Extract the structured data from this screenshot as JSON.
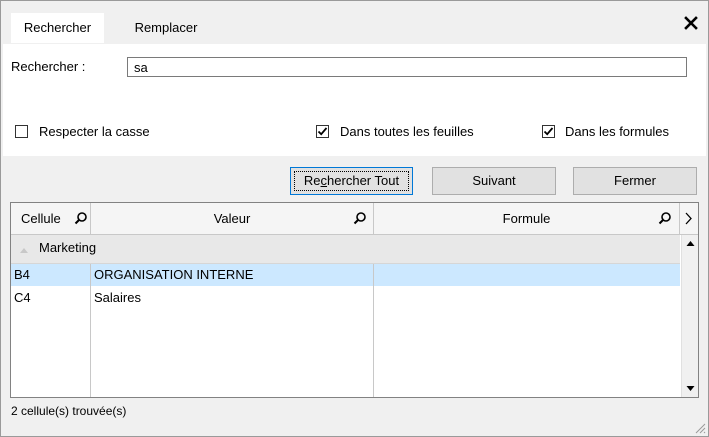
{
  "tabs": [
    {
      "label": "Rechercher",
      "active": true
    },
    {
      "label": "Remplacer",
      "active": false
    }
  ],
  "search": {
    "label": "Rechercher :",
    "value": "sa"
  },
  "options": {
    "match_case": {
      "label": "Respecter la casse",
      "checked": false
    },
    "all_sheets": {
      "label": "Dans toutes les feuilles",
      "checked": true
    },
    "in_formulas": {
      "label": "Dans les formules",
      "checked": true
    }
  },
  "buttons": {
    "find_all": {
      "prefix": "Re",
      "accel": "c",
      "suffix": "hercher Tout"
    },
    "next": "Suivant",
    "close": "Fermer"
  },
  "grid": {
    "columns": [
      "Cellule",
      "Valeur",
      "Formule"
    ],
    "group": "Marketing",
    "rows": [
      {
        "cell": "B4",
        "value": "ORGANISATION INTERNE",
        "formula": "",
        "selected": true
      },
      {
        "cell": "C4",
        "value": "Salaires",
        "formula": "",
        "selected": false
      }
    ]
  },
  "status": "2 cellule(s) trouvée(s)",
  "colors": {
    "selection": "#cce8ff",
    "focus_border": "#0078d7"
  }
}
